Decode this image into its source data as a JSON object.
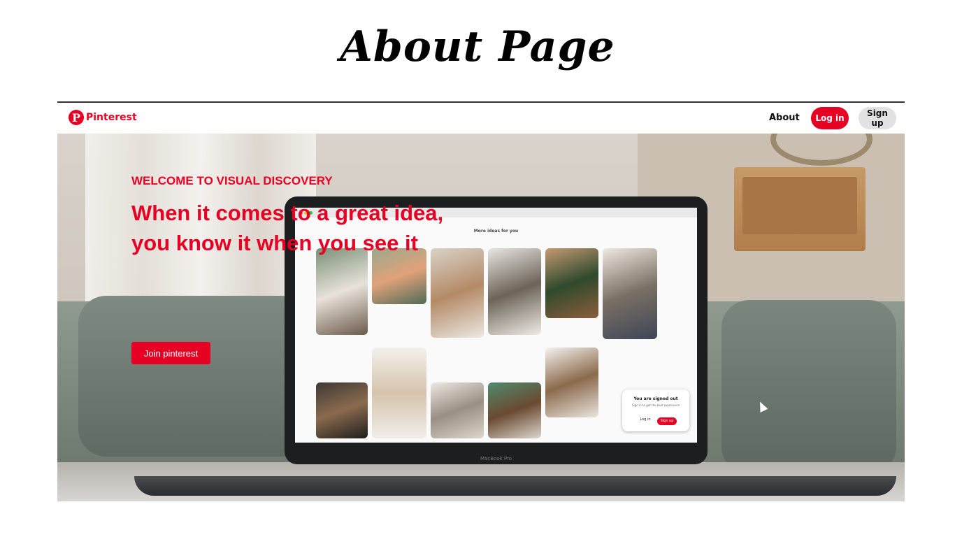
{
  "slide": {
    "title": "About Page"
  },
  "nav": {
    "logo_text": "Pinterest",
    "logo_mark": "P",
    "about": "About",
    "login": "Log in",
    "signup": "Sign up"
  },
  "hero": {
    "eyebrow": "WELCOME TO VISUAL DISCOVERY",
    "headline": "When it comes to a great idea, you know it when you see it",
    "cta": "Join pinterest"
  },
  "laptop": {
    "brand": "MacBook Pro",
    "screen_heading": "More ideas for you",
    "signed_out_title": "You are signed out",
    "signed_out_text": "Sign in to get the best experience",
    "signed_out_login": "Log in",
    "signed_out_signup": "Sign up"
  },
  "colors": {
    "brand": "#e60023",
    "signup_bg": "#e2e2e2"
  }
}
